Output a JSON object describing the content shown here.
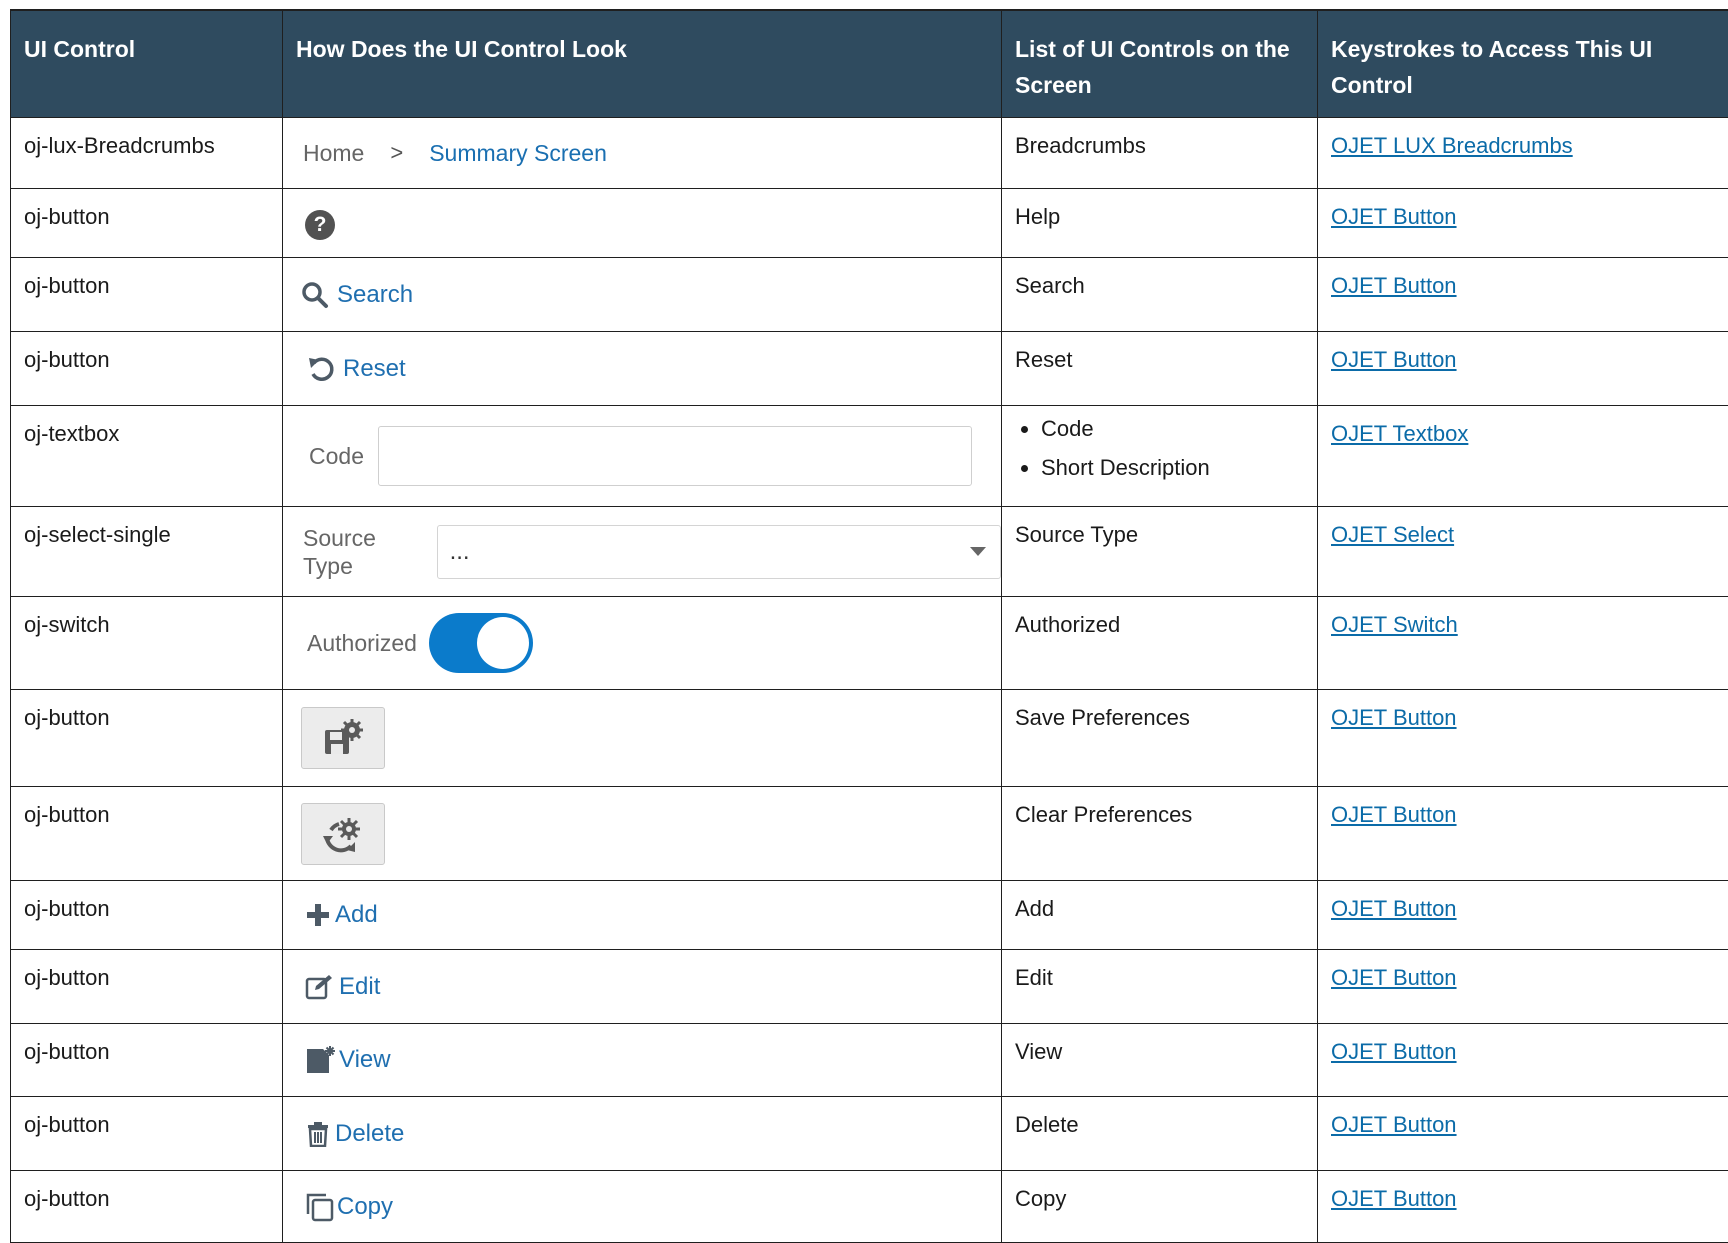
{
  "headers": [
    "UI Control",
    "How Does the UI Control Look",
    "List of UI Controls on the Screen",
    "Keystrokes to Access This UI Control"
  ],
  "rows": [
    {
      "control": "oj-lux-Breadcrumbs",
      "look": {
        "home": "Home",
        "separator": ">",
        "current": "Summary Screen"
      },
      "list": "Breadcrumbs",
      "link": "OJET LUX Breadcrumbs"
    },
    {
      "control": "oj-button",
      "look": {
        "icon": "help-icon",
        "glyph": "?"
      },
      "list": "Help",
      "link": "OJET Button"
    },
    {
      "control": "oj-button",
      "look": {
        "icon": "search-icon",
        "label": "Search"
      },
      "list": "Search",
      "link": "OJET Button"
    },
    {
      "control": "oj-button",
      "look": {
        "icon": "reset-icon",
        "label": "Reset"
      },
      "list": "Reset",
      "link": "OJET Button"
    },
    {
      "control": "oj-textbox",
      "look": {
        "label": "Code"
      },
      "list_items": [
        "Code",
        "Short Description"
      ],
      "link": "OJET Textbox"
    },
    {
      "control": "oj-select-single",
      "look": {
        "label": "Source Type",
        "value": "..."
      },
      "list": "Source Type",
      "link": "OJET Select"
    },
    {
      "control": "oj-switch",
      "look": {
        "label": "Authorized",
        "checked": true
      },
      "list": "Authorized",
      "link": "OJET Switch"
    },
    {
      "control": "oj-button",
      "look": {
        "icon": "save-preferences-icon"
      },
      "list": "Save Preferences",
      "link": "OJET Button"
    },
    {
      "control": "oj-button",
      "look": {
        "icon": "clear-preferences-icon"
      },
      "list": "Clear Preferences",
      "link": "OJET Button"
    },
    {
      "control": "oj-button",
      "look": {
        "icon": "plus-icon",
        "label": "Add"
      },
      "list": "Add",
      "link": "OJET Button"
    },
    {
      "control": "oj-button",
      "look": {
        "icon": "edit-icon",
        "label": "Edit"
      },
      "list": "Edit",
      "link": "OJET Button"
    },
    {
      "control": "oj-button",
      "look": {
        "icon": "view-icon",
        "label": "View"
      },
      "list": "View",
      "link": "OJET Button"
    },
    {
      "control": "oj-button",
      "look": {
        "icon": "trash-icon",
        "label": "Delete"
      },
      "list": "Delete",
      "link": "OJET Button"
    },
    {
      "control": "oj-button",
      "look": {
        "icon": "copy-icon",
        "label": "Copy"
      },
      "list": "Copy",
      "link": "OJET Button"
    }
  ],
  "colors": {
    "header_bg": "#2f4b5f",
    "link": "#0b6ba8",
    "button_text": "#1f6fb0",
    "switch_on": "#0b7bcb"
  }
}
